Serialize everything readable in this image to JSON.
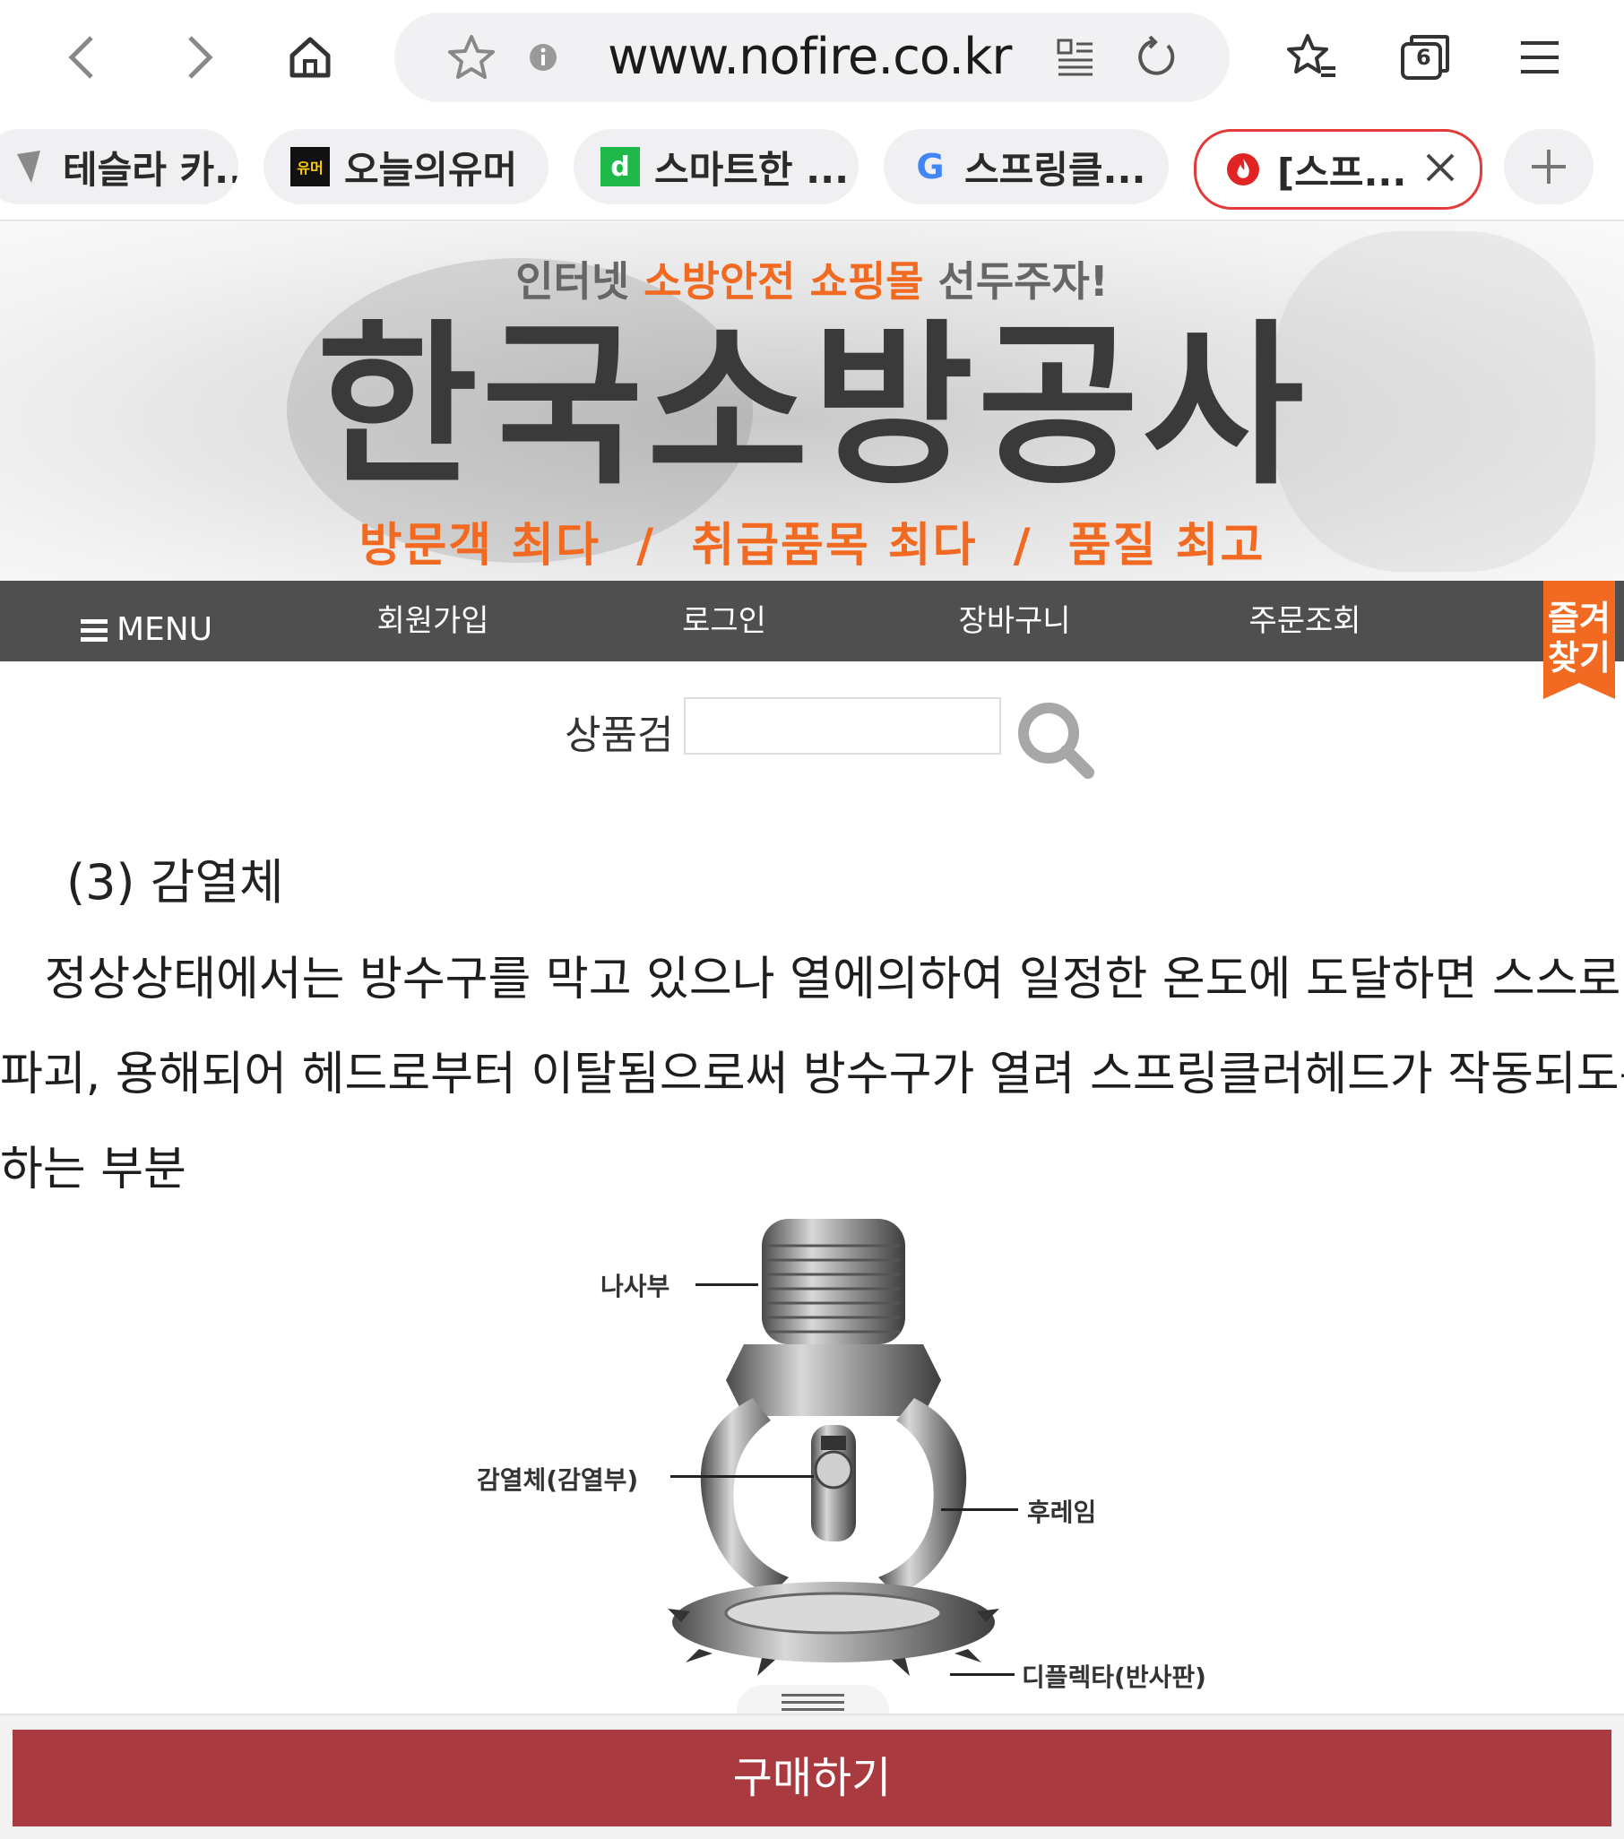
{
  "browser": {
    "url": "www.nofire.co.kr",
    "tab_count": "6",
    "tabs": [
      {
        "label": "테슬라 카..."
      },
      {
        "label": "오늘의유머",
        "favicon_text": "유머"
      },
      {
        "label": "스마트한 ...",
        "favicon_text": "d"
      },
      {
        "label": "스프링클...",
        "favicon_text": "G"
      },
      {
        "label": "[스프...",
        "active": true
      }
    ]
  },
  "banner": {
    "tagline_pre": "인터넷",
    "tagline_highlight": "소방안전 쇼핑몰",
    "tagline_post": "선두주자!",
    "logo": "한국소방공사",
    "subline": "방문객 최다  /  취급품목 최다  /  품질 최고"
  },
  "nav": {
    "menu": "MENU",
    "items": [
      "회원가입",
      "로그인",
      "장바구니",
      "주문조회"
    ],
    "favorite": [
      "즐겨",
      "찾기"
    ]
  },
  "search": {
    "label": "상품검",
    "value": ""
  },
  "article": {
    "heading": "(3) 감열체",
    "lines": [
      "   정상상태에서는 방수구를 막고 있으나 열에의하여 일정한 온도에 도달하면 스스로",
      "파괴, 용해되어 헤드로부터 이탈됨으로써 방수구가 열려 스프링클러헤드가 작동되도록",
      "하는 부분"
    ]
  },
  "figure": {
    "labels": {
      "thread": "나사부",
      "heat": "감열체(감열부)",
      "frame": "후레임",
      "deflector": "디플렉타(반사판)"
    }
  },
  "footer": {
    "buy": "구매하기"
  },
  "colors": {
    "accent": "#f26a21",
    "nav_bg": "#4f4f4f",
    "buy_bg": "#a83a40",
    "active_tab_border": "#e33a3a"
  }
}
